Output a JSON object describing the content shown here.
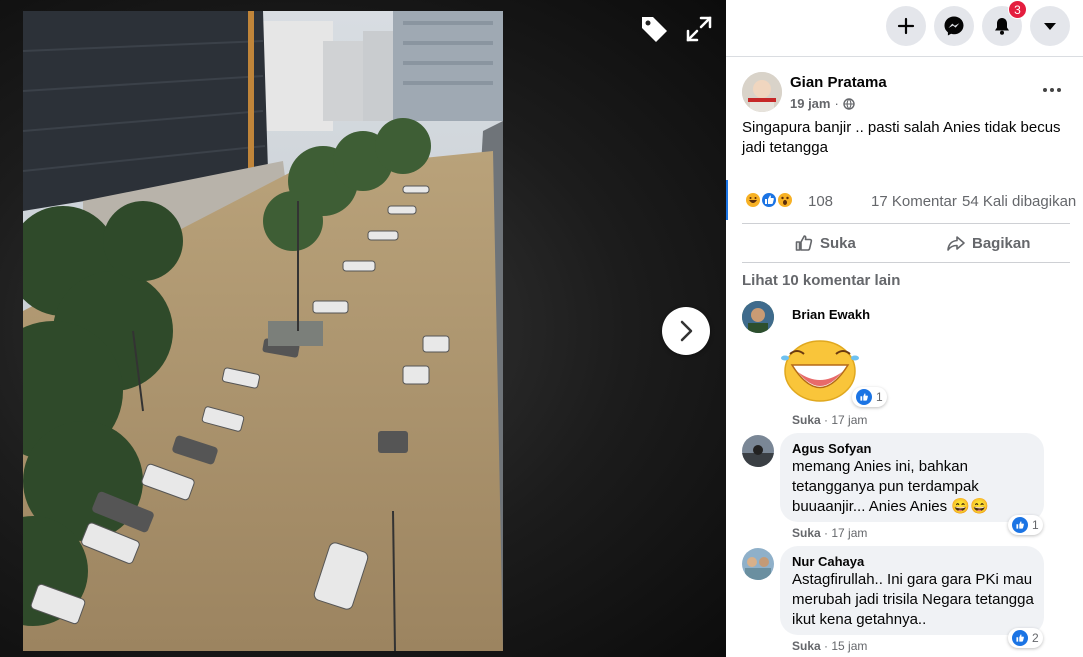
{
  "viewer": {
    "icons": [
      "tag-icon",
      "expand-icon",
      "chevron-right-icon"
    ]
  },
  "topbar": {
    "notification_count": "3"
  },
  "post": {
    "author": "Gian Pratama",
    "time": "19 jam",
    "separator": "·",
    "text": "Singapura banjir .. pasti salah Anies tidak becus jadi tetangga",
    "reaction_count": "108",
    "comment_count": "17 Komentar",
    "share_count": "54 Kali dibagikan",
    "like_label": "Suka",
    "share_label": "Bagikan",
    "more_comments": "Lihat 10 komentar lain"
  },
  "comments": [
    {
      "name": "Brian Ewakh",
      "text": "",
      "like_label": "Suka",
      "time": "· 17 jam",
      "likes": "1"
    },
    {
      "name": "Agus Sofyan",
      "text": "memang Anies ini, bahkan tetangganya pun terdampak buuaanjir... Anies Anies 😄😄",
      "like_label": "Suka",
      "time": "· 17 jam",
      "likes": "1"
    },
    {
      "name": "Nur Cahaya",
      "text": "Astagfirullah.. Ini gara gara PKi mau merubah jadi trisila Negara tetangga ikut kena getahnya..",
      "like_label": "Suka",
      "time": "· 15 jam",
      "likes": "2"
    }
  ],
  "colors": {
    "accent": "#1b74e4",
    "badge": "#e41e3f",
    "bubble": "#f0f2f5"
  }
}
